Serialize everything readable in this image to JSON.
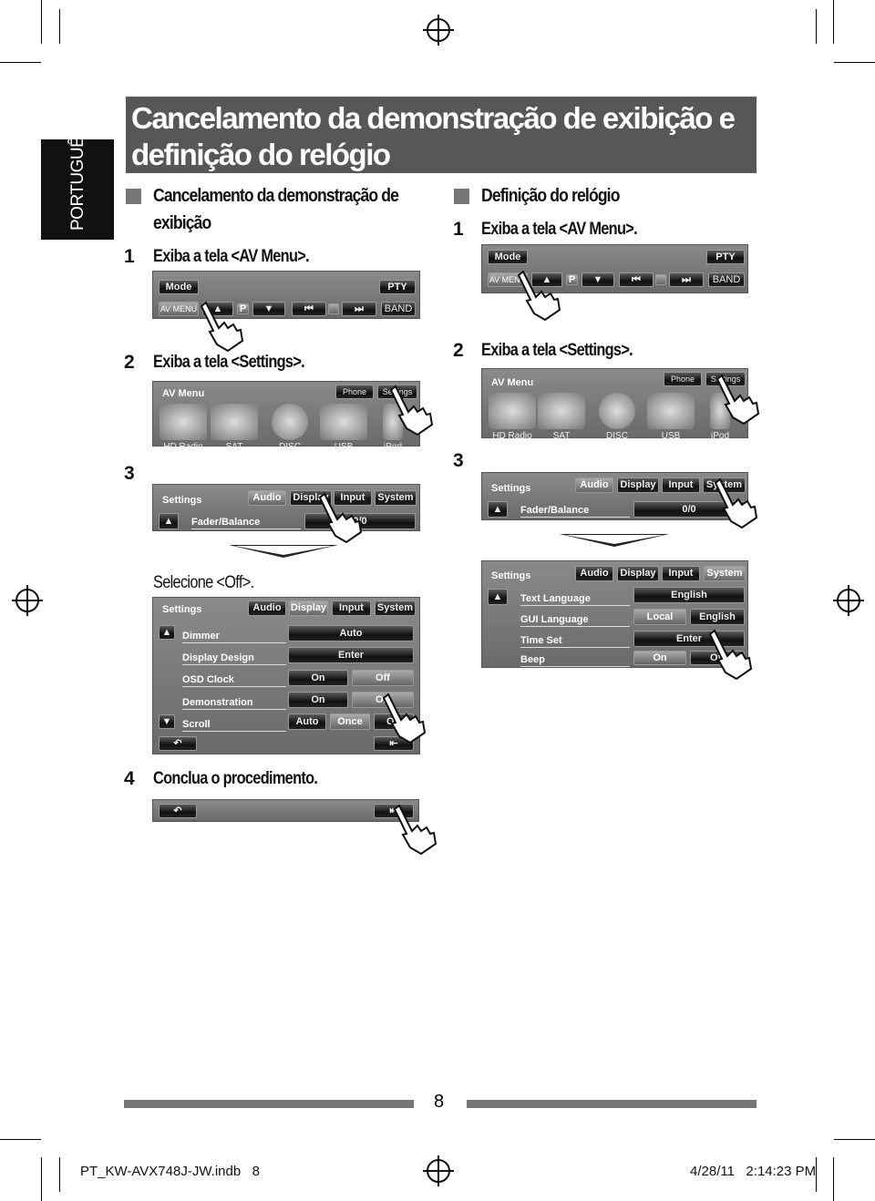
{
  "side_tab": "PORTUGUÊS",
  "title": "Cancelamento da demonstração de exibição e definição do relógio",
  "left": {
    "heading": "Cancelamento da demonstração de exibição",
    "steps": [
      {
        "n": "1",
        "text": "Exiba a tela <AV Menu>."
      },
      {
        "n": "2",
        "text": "Exiba a tela <Settings>."
      },
      {
        "n": "3",
        "text": ""
      },
      {
        "n": "4",
        "text": "Conclua o procedimento."
      }
    ],
    "select_text": "Selecione <Off>."
  },
  "right": {
    "heading": "Definição do relógio",
    "steps": [
      {
        "n": "1",
        "text": "Exiba a tela <AV Menu>."
      },
      {
        "n": "2",
        "text": "Exiba a tela <Settings>."
      },
      {
        "n": "3",
        "text": ""
      }
    ]
  },
  "source_screen": {
    "mode": "Mode",
    "pty": "PTY",
    "av_menu": "AV MENU",
    "p": "P",
    "band": "BAND"
  },
  "av_menu_screen": {
    "title": "AV Menu",
    "phone": "Phone",
    "settings": "Settings",
    "sources": [
      "HD Radio",
      "SAT",
      "DISC",
      "USB",
      "iPod"
    ]
  },
  "settings_tabs": {
    "title": "Settings",
    "tabs": [
      "Audio",
      "Display",
      "Input",
      "System"
    ]
  },
  "audio_screen": {
    "row": "Fader/Balance",
    "value": "0/0"
  },
  "display_screen": {
    "rows": [
      {
        "label": "Dimmer",
        "options": [
          "Auto"
        ]
      },
      {
        "label": "Display Design",
        "options": [
          "Enter"
        ]
      },
      {
        "label": "OSD Clock",
        "options": [
          "On",
          "Off"
        ]
      },
      {
        "label": "Demonstration",
        "options": [
          "On",
          "Off"
        ]
      },
      {
        "label": "Scroll",
        "options": [
          "Auto",
          "Once",
          "Off"
        ]
      }
    ]
  },
  "system_screen": {
    "rows": [
      {
        "label": "Text Language",
        "options": [
          "English"
        ]
      },
      {
        "label": "GUI Language",
        "options": [
          "Local",
          "English"
        ]
      },
      {
        "label": "Time Set",
        "options": [
          "Enter"
        ]
      },
      {
        "label": "Beep",
        "options": [
          "On",
          "Off"
        ]
      }
    ]
  },
  "page_number": "8",
  "footer": {
    "file": "PT_KW-AVX748J-JW.indb   8",
    "date": "4/28/11   2:14:23 PM"
  }
}
